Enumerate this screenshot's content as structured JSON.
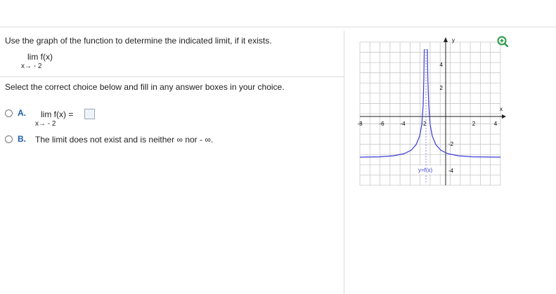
{
  "question": {
    "prompt": "Use the graph of the function to determine the indicated limit, if it exists.",
    "limit_expr": "lim  f(x)",
    "limit_sub": "x→ - 2",
    "instruction": "Select the correct choice below and fill in any answer boxes in your choice."
  },
  "choices": [
    {
      "letter": "A.",
      "expr": "lim  f(x) =",
      "sub": "x→ - 2",
      "answer": ""
    },
    {
      "letter": "B.",
      "text": "The limit does not exist and is neither ∞ nor  - ∞."
    }
  ],
  "graph": {
    "zoom_icon": "zoom-in-icon",
    "x_axis_label": "x",
    "y_axis_label": "y",
    "x_ticks": [
      "-8",
      "-6",
      "-4",
      "-2",
      "2",
      "4"
    ],
    "y_ticks": [
      "4",
      "2",
      "-2",
      "-4"
    ],
    "curve_label": "y=f(x)",
    "colors": {
      "curve": "#3b3bd6",
      "grid": "#c8c8c8",
      "axis": "#222222",
      "accent": "#2a9a4a"
    }
  }
}
